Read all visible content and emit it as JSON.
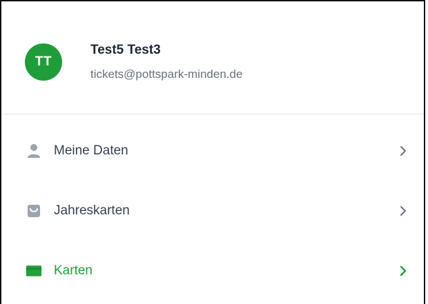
{
  "profile": {
    "initials": "TT",
    "name": "Test5 Test3",
    "email": "tickets@pottspark-minden.de",
    "avatar_color": "#1f9d3a"
  },
  "menu": {
    "items": [
      {
        "label": "Meine Daten",
        "icon": "user-icon",
        "active": false
      },
      {
        "label": "Jahreskarten",
        "icon": "shopping-bag-icon",
        "active": false
      },
      {
        "label": "Karten",
        "icon": "card-icon",
        "active": true
      }
    ],
    "colors": {
      "default_text": "#374151",
      "default_icon": "#9ca3af",
      "active": "#22a03b",
      "chevron": "#6b7280"
    }
  }
}
